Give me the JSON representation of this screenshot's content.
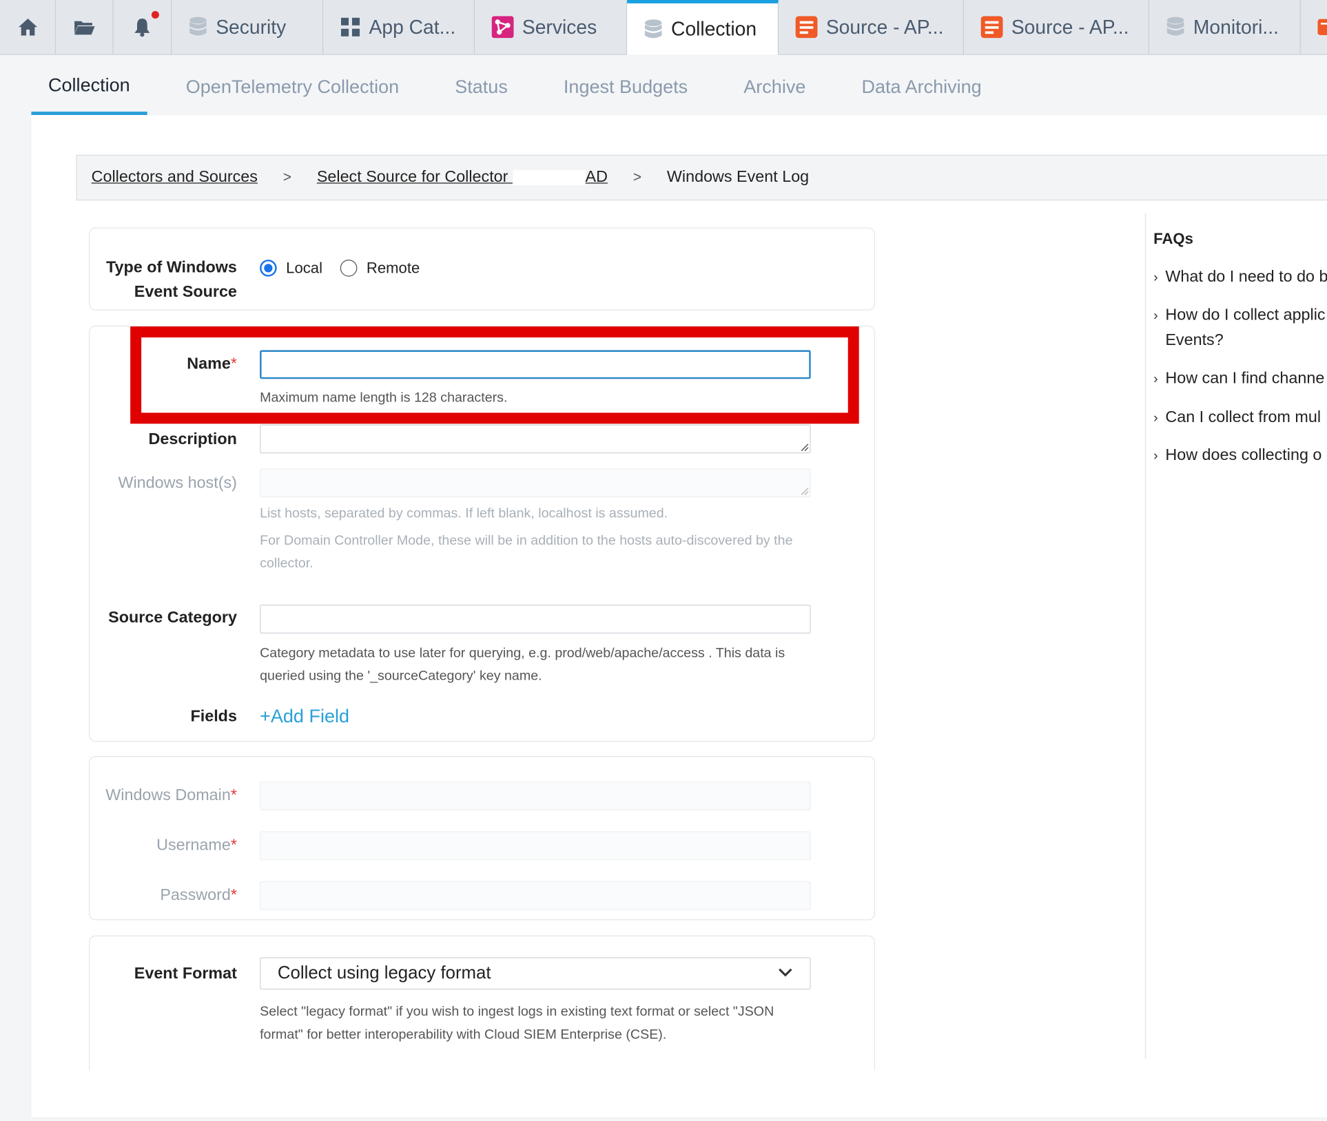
{
  "tabs": [
    {
      "label": "",
      "icon": "home-icon"
    },
    {
      "label": "",
      "icon": "folder-icon"
    },
    {
      "label": "",
      "icon": "bell-icon"
    },
    {
      "label": "Security",
      "icon": "database-icon"
    },
    {
      "label": "App Cat...",
      "icon": "app-grid-icon"
    },
    {
      "label": "Services",
      "icon": "services-icon"
    },
    {
      "label": "Collection",
      "icon": "database-icon"
    },
    {
      "label": "Source - AP...",
      "icon": "document-icon"
    },
    {
      "label": "Source - AP...",
      "icon": "document-icon"
    },
    {
      "label": "Monitori...",
      "icon": "database-icon"
    }
  ],
  "subnav": [
    {
      "label": "Collection"
    },
    {
      "label": "OpenTelemetry Collection"
    },
    {
      "label": "Status"
    },
    {
      "label": "Ingest Budgets"
    },
    {
      "label": "Archive"
    },
    {
      "label": "Data Archiving"
    }
  ],
  "breadcrumb": {
    "item1": "Collectors and Sources",
    "item2": "Select Source for Collector",
    "item2_suffix": "AD",
    "current": "Windows Event Log",
    "sep": ">"
  },
  "form": {
    "source_type": {
      "label_line1": "Type of Windows",
      "label_line2": "Event Source",
      "local": "Local",
      "remote": "Remote",
      "selected": "Local"
    },
    "name": {
      "label": "Name",
      "required": "*",
      "value": "",
      "help": "Maximum name length is 128 characters."
    },
    "description": {
      "label": "Description",
      "value": ""
    },
    "hosts": {
      "label": "Windows host(s)",
      "value": "",
      "help1": "List hosts, separated by commas. If left blank, localhost is assumed.",
      "help2": "For Domain Controller Mode, these will be in addition to the hosts auto-discovered by the collector."
    },
    "source_category": {
      "label": "Source Category",
      "value": "",
      "help": "Category metadata to use later for querying, e.g. prod/web/apache/access . This data is queried using the '_sourceCategory' key name."
    },
    "fields": {
      "label": "Fields",
      "add": "+Add Field"
    },
    "domain": {
      "label": "Windows Domain",
      "required": "*",
      "value": ""
    },
    "username": {
      "label": "Username",
      "required": "*",
      "value": ""
    },
    "password": {
      "label": "Password",
      "required": "*",
      "value": ""
    },
    "event_format": {
      "label": "Event Format",
      "value": "Collect using legacy format",
      "help": "Select \"legacy format\" if you wish to ingest logs in existing text format or select \"JSON format\" for better interoperability with Cloud SIEM Enterprise (CSE)."
    }
  },
  "faqs": {
    "title": "FAQs",
    "items": [
      {
        "line1": "What do I need to do b",
        "line2": ""
      },
      {
        "line1": "How do I collect applic",
        "line2": "Events?"
      },
      {
        "line1": "How can I find channe",
        "line2": ""
      },
      {
        "line1": "Can I collect from mul",
        "line2": ""
      },
      {
        "line1": "How does collecting o",
        "line2": ""
      }
    ]
  },
  "colors": {
    "accent": "#2a9fd8",
    "highlight": "#e00000",
    "required": "#e0393e",
    "services_icon": "#d6247f",
    "document_icon": "#f05a28"
  }
}
